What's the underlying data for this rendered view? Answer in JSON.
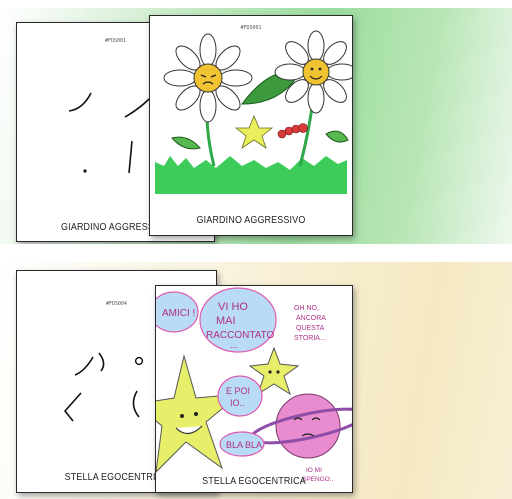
{
  "gallery": {
    "items": [
      {
        "outline_card": {
          "tag": "#FDS001",
          "caption": "GIARDINO AGGRESSIVO"
        },
        "colored_card": {
          "tag": "#FDS001",
          "caption": "GIARDINO AGGRESSIVO"
        }
      },
      {
        "outline_card": {
          "tag": "#FDS004",
          "caption": "STELLA EGOCENTRICA"
        },
        "colored_card": {
          "tag": "#FDS004",
          "caption": "STELLA EGOCENTRICA",
          "speech": {
            "bubble1": "AMICI !",
            "bubble2": [
              "VI HO",
              "MAI",
              "RACCONTATO",
              "..."
            ],
            "bubble3": [
              "E POI",
              "IO.."
            ],
            "bubble4": "BLA BLA",
            "note1": [
              "OH NO,",
              "ANCORA",
              "QUESTA",
              "STORIA..."
            ],
            "note2": [
              "IO MI",
              "SPENGO.."
            ]
          }
        }
      }
    ]
  },
  "colors": {
    "panel1_accent": "#9bdc9f",
    "panel2_accent": "#f5e9c2",
    "grass": "#3dcc5a",
    "star": "#e7ef6a",
    "planet": "#e88bcf",
    "bubble": "#b9dbf5"
  }
}
